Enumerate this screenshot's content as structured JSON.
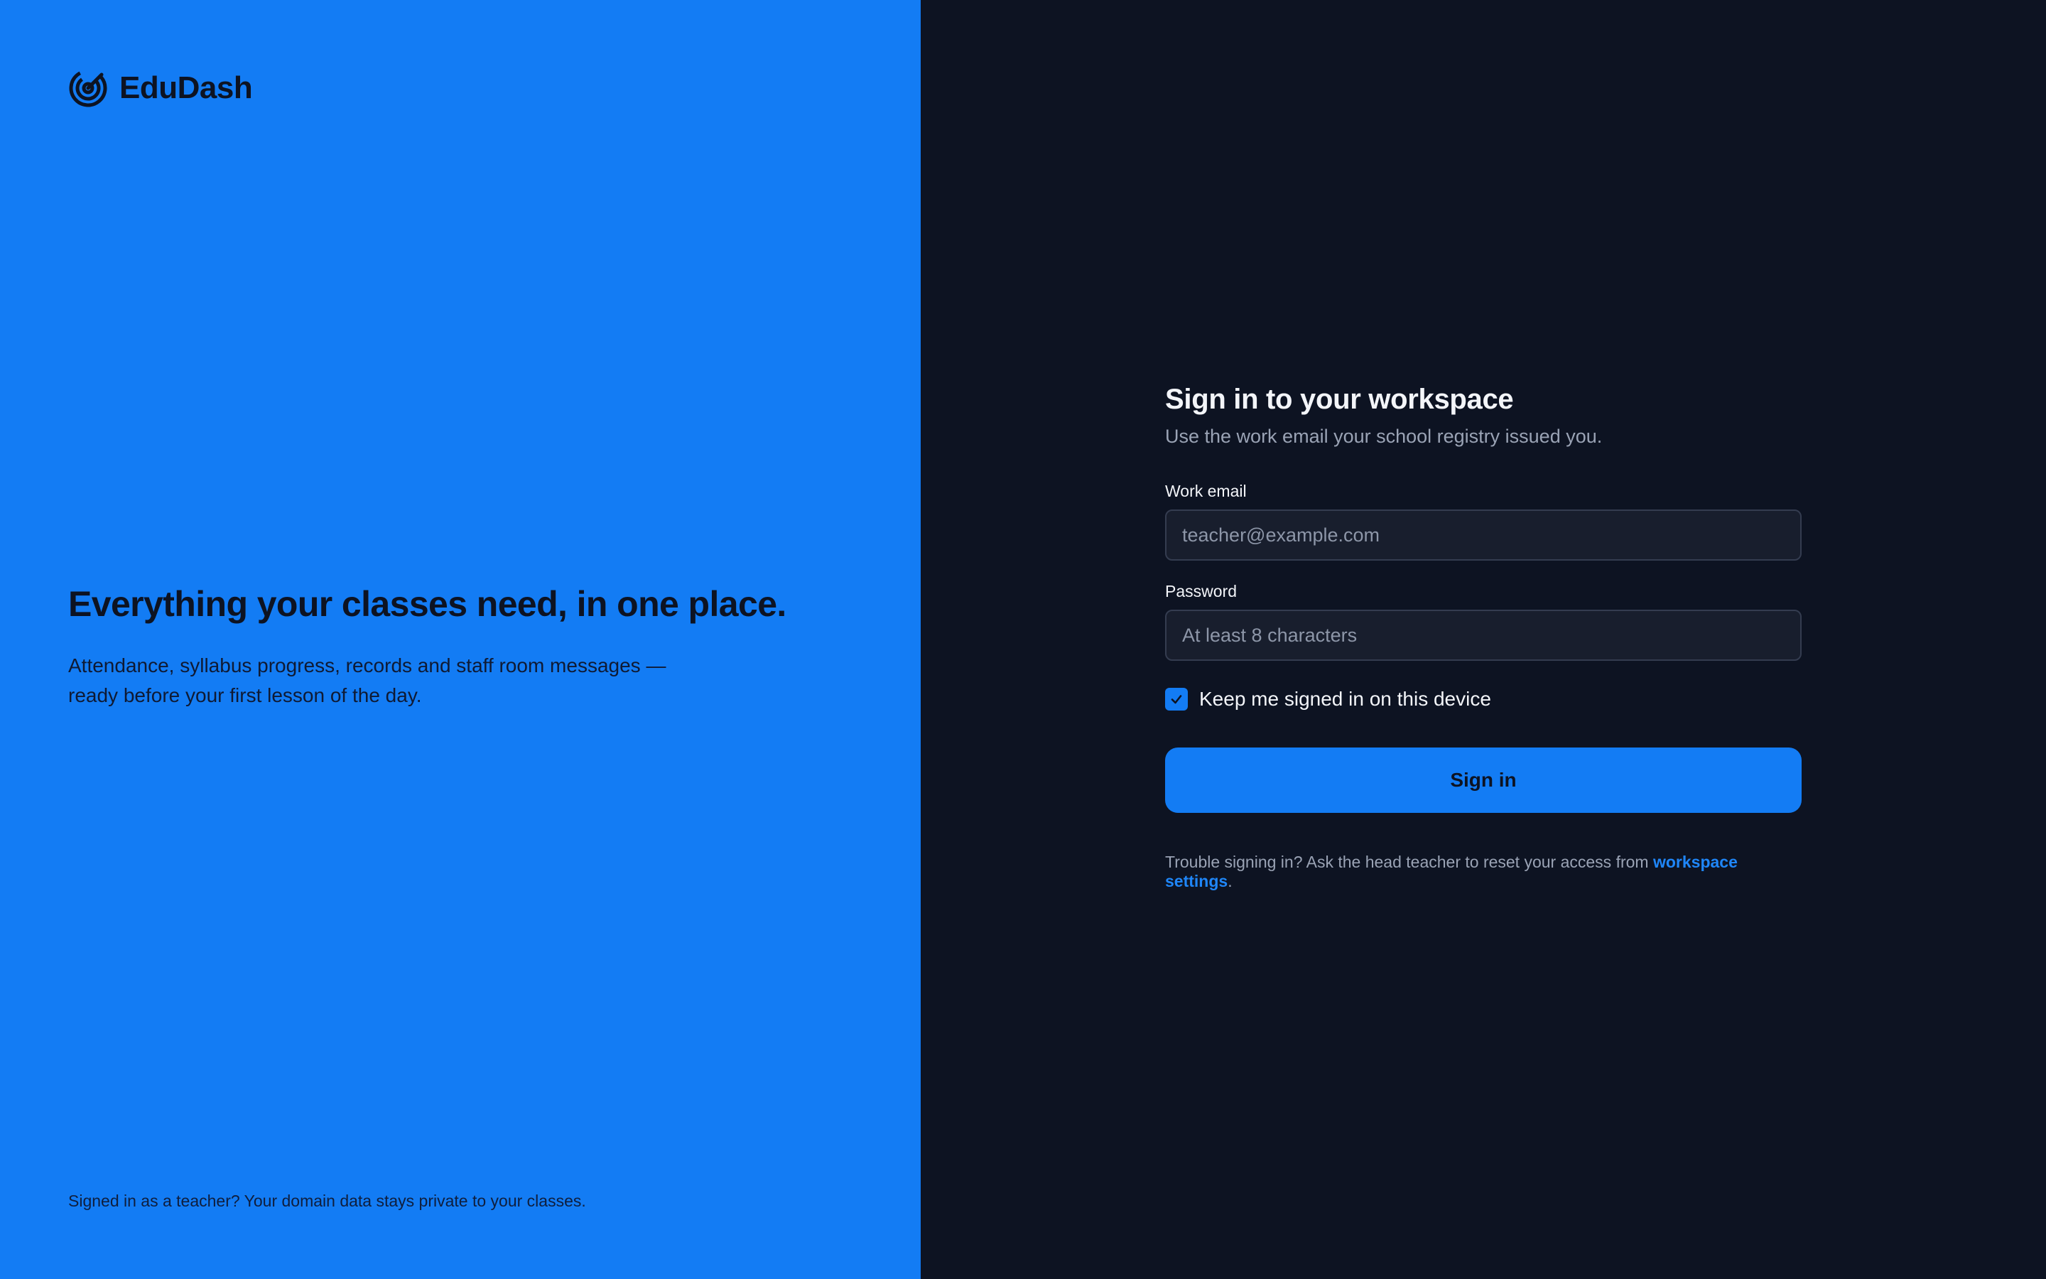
{
  "brand": {
    "name": "EduDash",
    "headline": "Everything your classes need, in one place.",
    "subtext": "Attendance, syllabus progress, records and staff room messages — ready before your first lesson of the day.",
    "footer": "Signed in as a teacher? Your domain data stays private to your classes.",
    "logo_icon": "target-rings-icon"
  },
  "form": {
    "title": "Sign in to your workspace",
    "subtitle": "Use the work email your school registry issued you.",
    "email": {
      "label": "Work email",
      "placeholder": "teacher@example.com",
      "value": ""
    },
    "password": {
      "label": "Password",
      "placeholder": "At least 8 characters",
      "value": ""
    },
    "remember": {
      "label": "Keep me signed in on this device",
      "checked": true
    },
    "submit_label": "Sign in",
    "help": {
      "text": "Trouble signing in? Ask the head teacher to reset your access from ",
      "link_text": "workspace settings",
      "suffix": "."
    }
  },
  "colors": {
    "brand_blue": "#137cf4",
    "dark_bg": "#0d1322",
    "input_bg": "#181e2d",
    "input_border": "#343c50",
    "muted_text": "#9aa3b5",
    "link": "#1f86f8"
  }
}
